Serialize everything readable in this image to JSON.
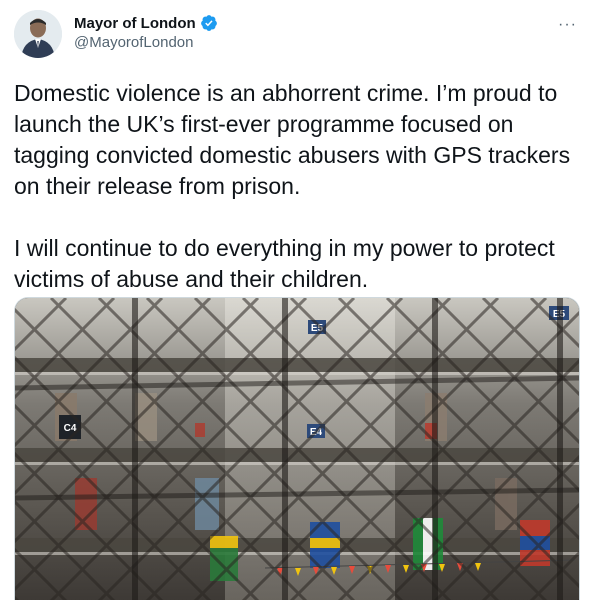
{
  "author": {
    "display_name": "Mayor of London",
    "handle": "@MayorofLondon",
    "verified": true
  },
  "menu": {
    "icon": "more-horizontal-icon",
    "label": "···"
  },
  "tweet": {
    "paragraphs": [
      "Domestic violence is an abhorrent crime. I’m proud to launch the UK’s first-ever programme focused on tagging convicted domestic abusers with GPS trackers on their release from prison.",
      "I will continue to do everything in my power to protect victims of abuse and their children."
    ]
  },
  "media": {
    "landing_labels": [
      "E5",
      "E4",
      "C4",
      "E5"
    ]
  },
  "colors": {
    "verified_blue": "#1d9bf0",
    "text": "#0f1419",
    "muted": "#536471"
  }
}
